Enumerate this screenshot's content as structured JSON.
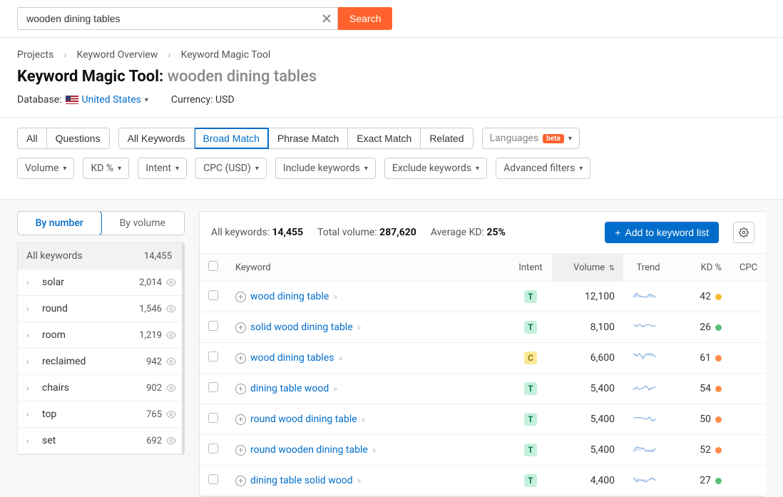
{
  "search": {
    "value": "wooden dining tables",
    "button": "Search"
  },
  "breadcrumbs": [
    "Projects",
    "Keyword Overview",
    "Keyword Magic Tool"
  ],
  "page_title": {
    "prefix": "Keyword Magic Tool:",
    "query": "wooden dining tables"
  },
  "database": {
    "label": "Database:",
    "country": "United States"
  },
  "currency": {
    "label": "Currency:",
    "value": "USD"
  },
  "filter_tabs_group1": [
    {
      "label": "All",
      "active": false
    },
    {
      "label": "Questions",
      "active": false
    }
  ],
  "filter_tabs_group2": [
    {
      "label": "All Keywords",
      "active": false
    },
    {
      "label": "Broad Match",
      "active": true
    },
    {
      "label": "Phrase Match",
      "active": false
    },
    {
      "label": "Exact Match",
      "active": false
    },
    {
      "label": "Related",
      "active": false
    }
  ],
  "languages": {
    "label": "Languages",
    "badge": "beta"
  },
  "filter_dropdowns": [
    "Volume",
    "KD %",
    "Intent",
    "CPC (USD)",
    "Include keywords",
    "Exclude keywords",
    "Advanced filters"
  ],
  "sidebar_tabs": [
    {
      "label": "By number",
      "active": true
    },
    {
      "label": "By volume",
      "active": false
    }
  ],
  "sidebar_header": {
    "label": "All keywords",
    "count": "14,455"
  },
  "sidebar_items": [
    {
      "name": "solar",
      "count": "2,014"
    },
    {
      "name": "round",
      "count": "1,546"
    },
    {
      "name": "room",
      "count": "1,219"
    },
    {
      "name": "reclaimed",
      "count": "942"
    },
    {
      "name": "chairs",
      "count": "902"
    },
    {
      "name": "top",
      "count": "765"
    },
    {
      "name": "set",
      "count": "692"
    }
  ],
  "summary": {
    "all_keywords_label": "All keywords:",
    "all_keywords_value": "14,455",
    "total_volume_label": "Total volume:",
    "total_volume_value": "287,620",
    "avg_kd_label": "Average KD:",
    "avg_kd_value": "25%",
    "add_button": "Add to keyword list"
  },
  "columns": {
    "keyword": "Keyword",
    "intent": "Intent",
    "volume": "Volume",
    "trend": "Trend",
    "kd": "KD %",
    "cpc": "CPC"
  },
  "rows": [
    {
      "keyword": "wood dining table",
      "intent": "T",
      "volume": "12,100",
      "kd": "42",
      "kd_color": "yellow"
    },
    {
      "keyword": "solid wood dining table",
      "intent": "T",
      "volume": "8,100",
      "kd": "26",
      "kd_color": "green"
    },
    {
      "keyword": "wood dining tables",
      "intent": "C",
      "volume": "6,600",
      "kd": "61",
      "kd_color": "orange"
    },
    {
      "keyword": "dining table wood",
      "intent": "T",
      "volume": "5,400",
      "kd": "54",
      "kd_color": "orange"
    },
    {
      "keyword": "round wood dining table",
      "intent": "T",
      "volume": "5,400",
      "kd": "50",
      "kd_color": "orange"
    },
    {
      "keyword": "round wooden dining table",
      "intent": "T",
      "volume": "5,400",
      "kd": "52",
      "kd_color": "orange"
    },
    {
      "keyword": "dining table solid wood",
      "intent": "T",
      "volume": "4,400",
      "kd": "27",
      "kd_color": "green"
    }
  ]
}
